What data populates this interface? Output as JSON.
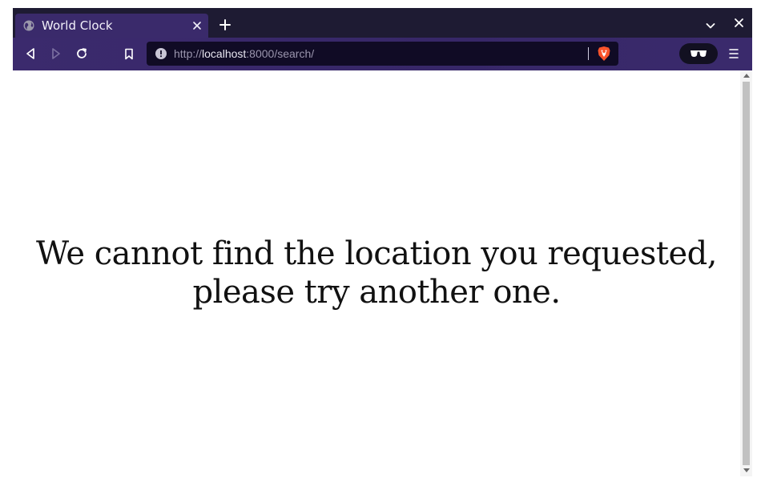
{
  "tab": {
    "title": "World Clock",
    "favicon": "globe-icon",
    "close_icon": "close-icon"
  },
  "tabstrip": {
    "new_tab_icon": "plus-icon",
    "dropdown_icon": "chevron-down-icon",
    "window_close_icon": "close-icon"
  },
  "toolbar": {
    "back_icon": "back-icon",
    "forward_icon": "forward-icon",
    "reload_icon": "reload-icon",
    "bookmark_icon": "bookmark-icon",
    "shields_icon": "brave-shield-icon",
    "privacy_icon": "sunglasses-icon",
    "menu_icon": "hamburger-menu-icon"
  },
  "urlbar": {
    "scheme": "http://",
    "host": "localhost",
    "rest": ":8000/search/",
    "info_icon": "info-icon"
  },
  "page": {
    "message": "We cannot find the location you requested, please try another one."
  },
  "colors": {
    "tabstrip_bg": "#1e1b33",
    "tab_active_bg": "#3a2a6b",
    "toolbar_bg": "#3a2a6c",
    "urlbar_bg": "#100b25",
    "shield_orange": "#fb542b",
    "text_dark": "#111111"
  }
}
